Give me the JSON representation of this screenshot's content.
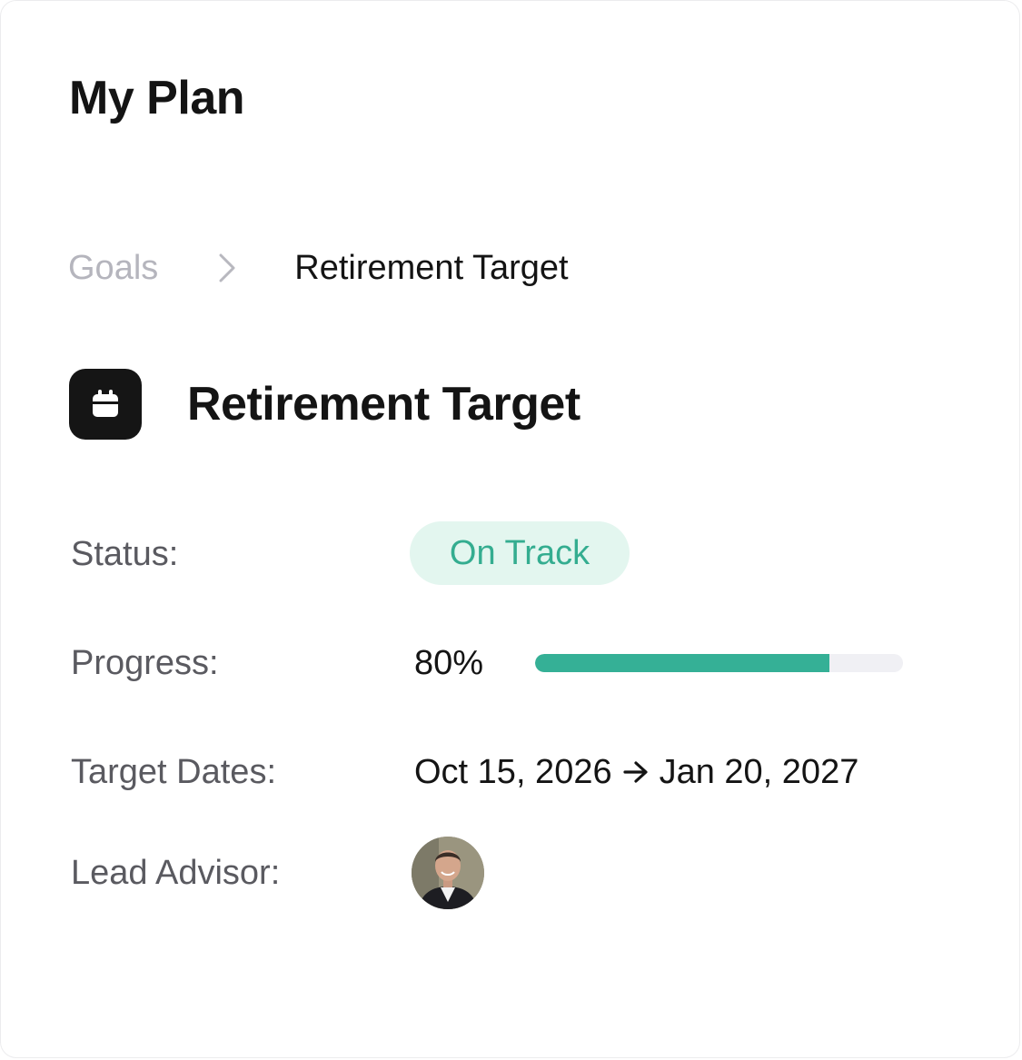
{
  "header": {
    "title": "My Plan"
  },
  "breadcrumb": {
    "parent": "Goals",
    "separator_icon": "chevron-right-icon",
    "current": "Retirement Target"
  },
  "goal": {
    "icon": "calendar-icon",
    "title": "Retirement Target"
  },
  "fields": {
    "status": {
      "label": "Status:",
      "value": "On Track",
      "badge_bg": "#e3f6ef",
      "badge_color": "#34ad90"
    },
    "progress": {
      "label": "Progress:",
      "value_text": "80%",
      "fraction": 0.8,
      "fill_color": "#35b096",
      "track_color": "#f0f0f4"
    },
    "target_dates": {
      "label": "Target Dates:",
      "start": "Oct 15, 2026",
      "arrow_icon": "arrow-right-icon",
      "end": "Jan 20, 2027"
    },
    "lead_advisor": {
      "label": "Lead Advisor:",
      "avatar_icon": "advisor-avatar"
    }
  }
}
